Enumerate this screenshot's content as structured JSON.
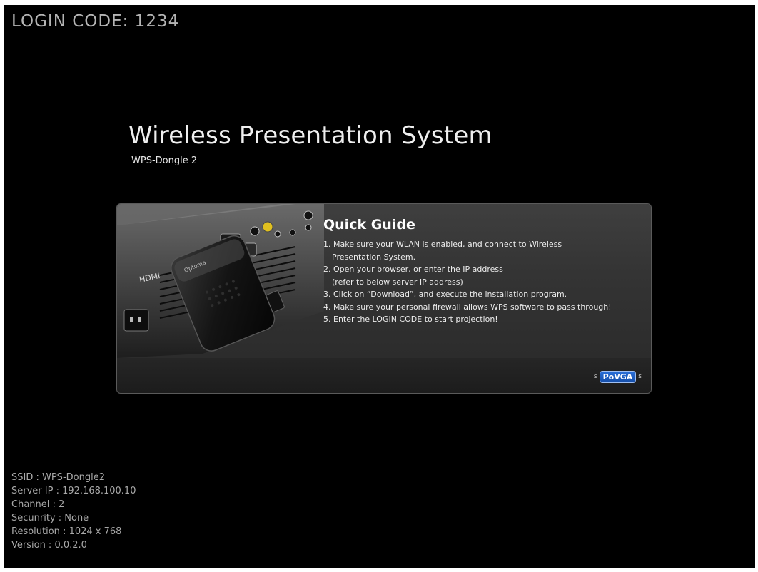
{
  "login": {
    "text": "LOGIN CODE: 1234"
  },
  "header": {
    "title": "Wireless Presentation System",
    "subtitle": "WPS-Dongle 2"
  },
  "guide": {
    "heading": "Quick Guide",
    "steps": [
      {
        "line1": "1. Make sure your WLAN is enabled, and connect to Wireless",
        "line2": "Presentation System."
      },
      {
        "line1": "2. Open your browser, or enter the IP address",
        "line2": "(refer to below server IP address)"
      },
      {
        "line1": "3. Click on “Download”, and execute the installation program.",
        "line2": ""
      },
      {
        "line1": "4. Make sure your personal firewall allows WPS software to pass through!",
        "line2": ""
      },
      {
        "line1": "5. Enter the LOGIN CODE to start projection!",
        "line2": ""
      }
    ],
    "logo_text": "PoVGA",
    "logo_dot": "s",
    "image_brand": "Optoma",
    "image_port": "HDMI"
  },
  "info": {
    "ssid": "SSID : WPS-Dongle2",
    "server_ip": "Server IP : 192.168.100.10",
    "channel": "Channel : 2",
    "security": "Secunrity : None",
    "resolution": "Resolution : 1024 x 768",
    "version": "Version : 0.0.2.0"
  }
}
